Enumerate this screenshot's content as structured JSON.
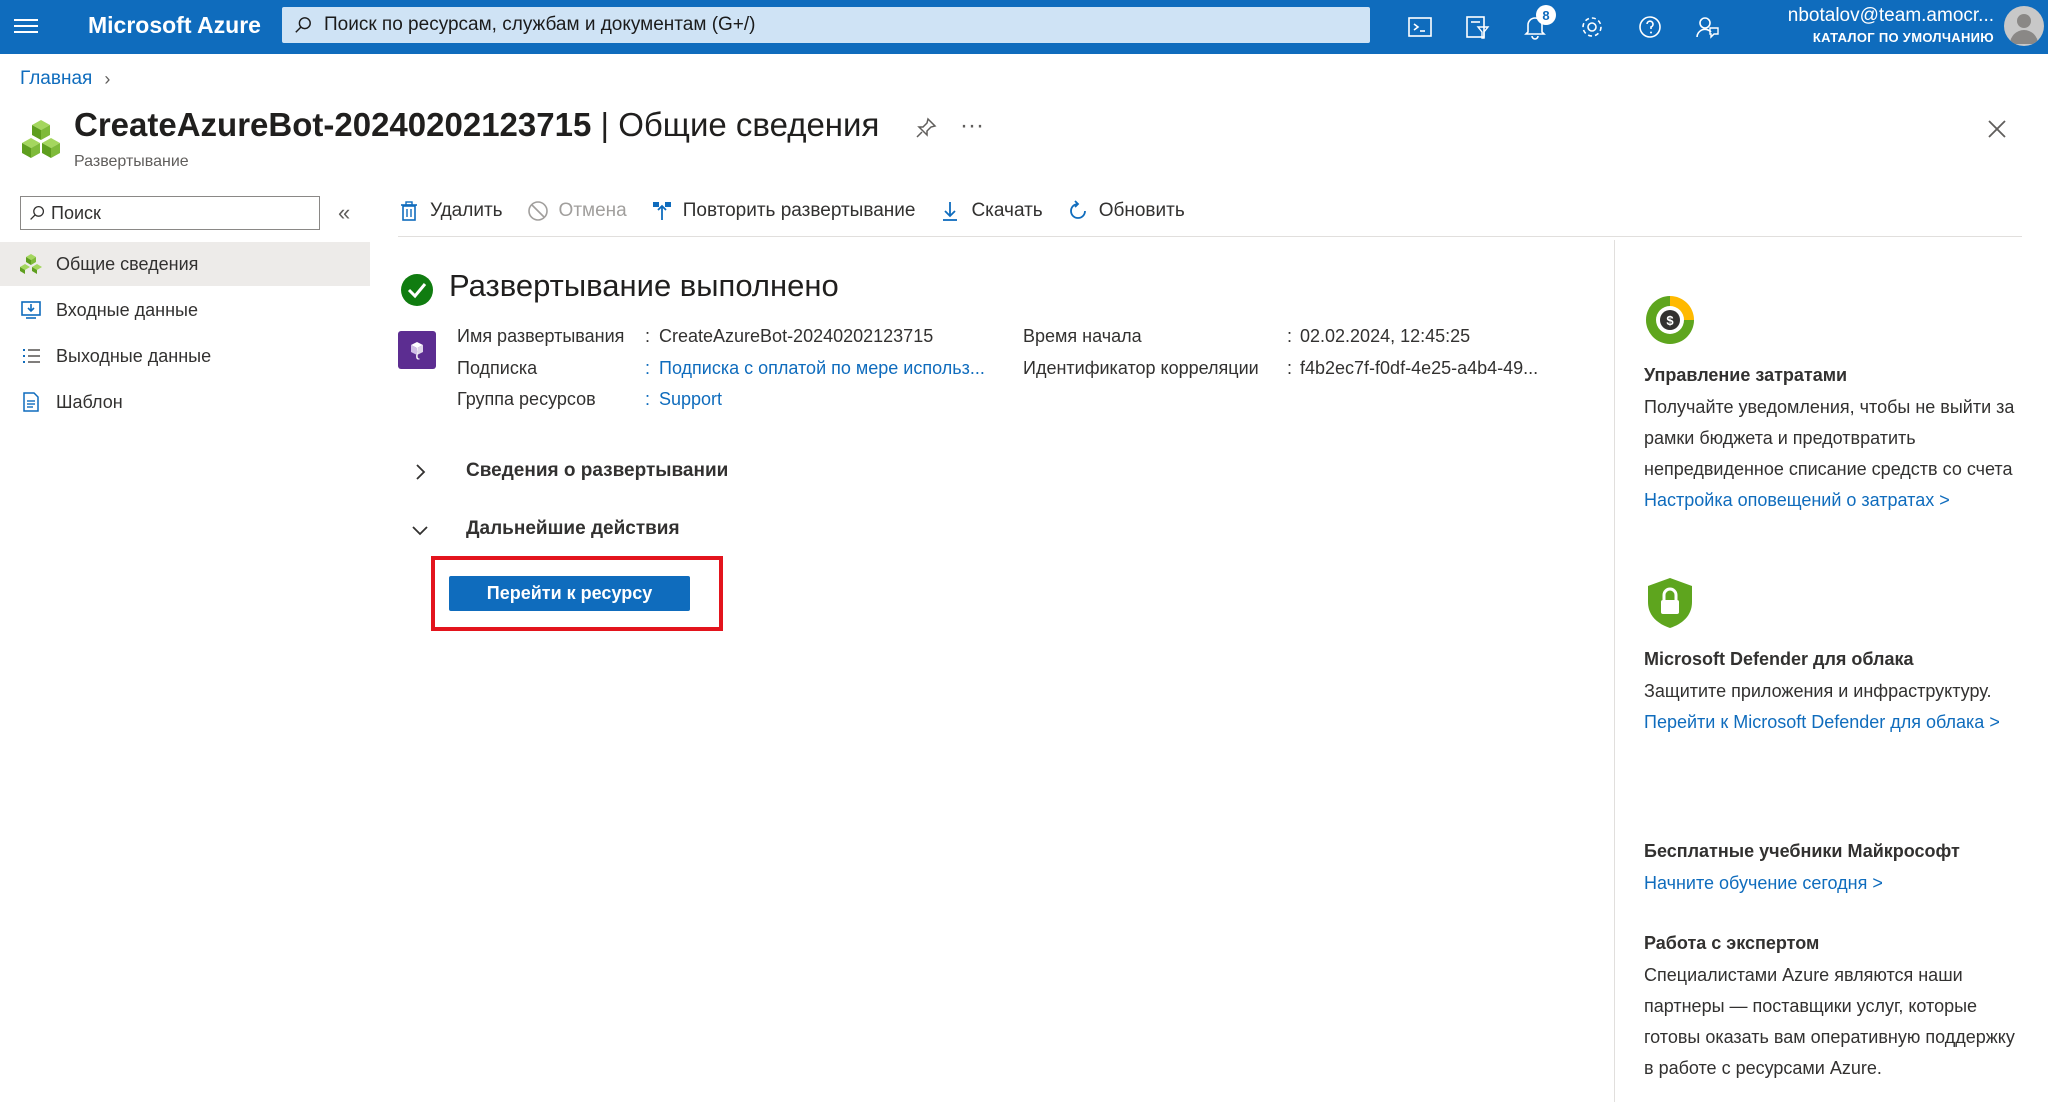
{
  "topbar": {
    "brand": "Microsoft Azure",
    "search_placeholder": "Поиск по ресурсам, службам и документам (G+/)",
    "notification_count": "8",
    "user": "nbotalov@team.amocr...",
    "directory": "КАТАЛОГ ПО УМОЛЧАНИЮ",
    "icons": [
      "cloud-shell-icon",
      "directory-filter-icon",
      "bell-icon",
      "gear-icon",
      "help-icon",
      "feedback-icon"
    ]
  },
  "breadcrumb": {
    "home": "Главная"
  },
  "header": {
    "title_bold": "CreateAzureBot-20240202123715",
    "title_rest": " | Общие сведения",
    "subtitle": "Развертывание",
    "more": "···"
  },
  "nav": {
    "search_placeholder": "Поиск",
    "collapse": "«",
    "items": [
      {
        "label": "Общие сведения",
        "icon": "overview-icon",
        "active": true
      },
      {
        "label": "Входные данные",
        "icon": "inputs-icon"
      },
      {
        "label": "Выходные данные",
        "icon": "outputs-icon"
      },
      {
        "label": "Шаблон",
        "icon": "template-icon"
      }
    ]
  },
  "toolbar": {
    "delete": "Удалить",
    "cancel": "Отмена",
    "redeploy": "Повторить развертывание",
    "download": "Скачать",
    "refresh": "Обновить"
  },
  "main": {
    "status_title": "Развертывание выполнено",
    "details": {
      "name_label": "Имя развертывания",
      "name_value": "CreateAzureBot-20240202123715",
      "subscription_label": "Подписка",
      "subscription_value": "Подписка с оплатой по мере использ...",
      "rg_label": "Группа ресурсов",
      "rg_value": "Support",
      "start_label": "Время начала",
      "start_value": "02.02.2024, 12:45:25",
      "corr_label": "Идентификатор корреляции",
      "corr_value": "f4b2ec7f-f0df-4e25-a4b4-49...",
      "sep": ":"
    },
    "section_details": "Сведения о развертывании",
    "section_next": "Дальнейшие действия",
    "go_button": "Перейти к ресурсу"
  },
  "right_panel": {
    "cost_title": "Управление затратами",
    "cost_text": "Получайте уведомления, чтобы не выйти за рамки бюджета и предотвратить непредвиденное списание средств со счета",
    "cost_link": "Настройка оповещений о затратах >",
    "defender_title": "Microsoft Defender для облака",
    "defender_text": "Защитите приложения и инфраструктуру.",
    "defender_link": "Перейти к Microsoft Defender для облака >",
    "learn_title": "Бесплатные учебники Майкрософт",
    "learn_link": "Начните обучение сегодня >",
    "expert_title": "Работа с экспертом",
    "expert_text": "Специалистами Azure являются наши партнеры — поставщики услуг, которые готовы оказать вам оперативную поддержку в работе с ресурсами Azure."
  },
  "colors": {
    "azure_blue": "#0f6cbd",
    "success_green": "#107c10",
    "highlight_red": "#e3141d"
  }
}
